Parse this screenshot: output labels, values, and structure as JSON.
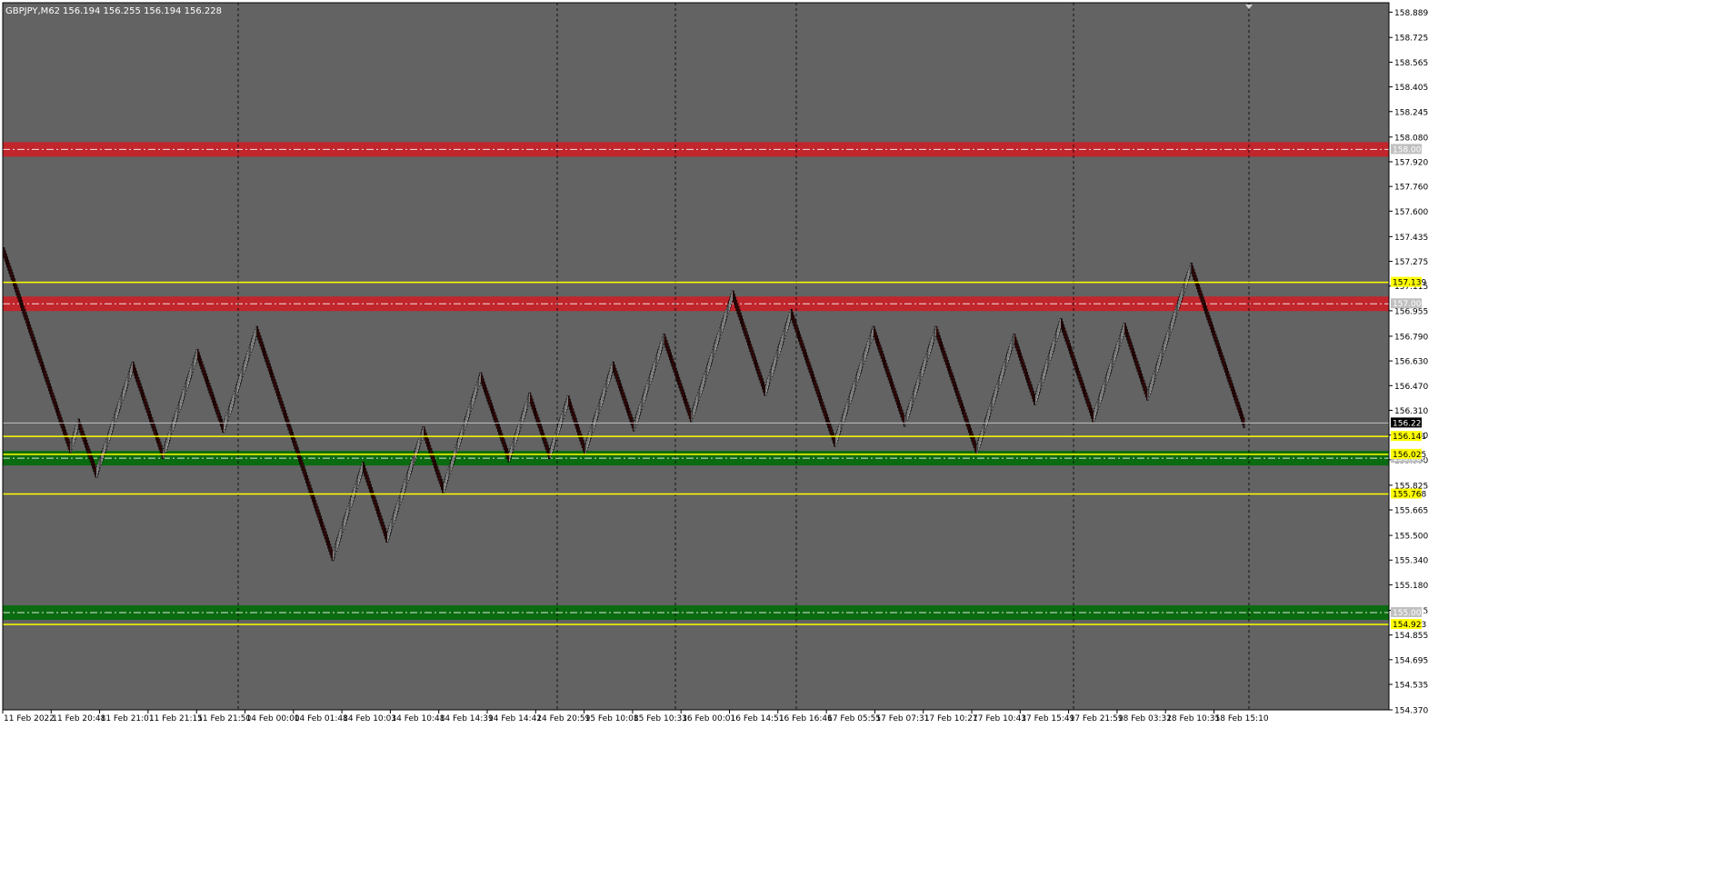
{
  "header": {
    "symbol": "GBPJPY,M62",
    "ohlc": "156.194 156.255 156.194 156.228"
  },
  "colors": {
    "plot_bg": "#636363",
    "axis_bg": "#ffffff",
    "bull_fill": "#ffffff",
    "bull_outline": "#000000",
    "bear_fill": "#5a0f0f",
    "bear_outline": "#000000",
    "red_zone": "#c0262c",
    "green_zone": "#0b6b10",
    "yellow_line": "#ffff00",
    "bid_line": "#c0c0c0",
    "grid": "#000000"
  },
  "chart_data": {
    "type": "renko",
    "ylim": [
      154.37,
      158.95
    ],
    "grid": "vertical dashed",
    "y_ticks": [
      "158.889",
      "158.725",
      "158.565",
      "158.405",
      "158.245",
      "158.080",
      "157.920",
      "157.760",
      "157.600",
      "157.435",
      "157.275",
      "157.115",
      "156.955",
      "156.790",
      "156.630",
      "156.470",
      "156.310",
      "156.150",
      "155.990",
      "155.825",
      "155.665",
      "155.500",
      "155.340",
      "155.180",
      "155.015",
      "154.855",
      "154.695",
      "154.535",
      "154.370"
    ],
    "x_labels": [
      "11 Feb 2022",
      "11 Feb 20:48",
      "11 Feb 21:01",
      "11 Feb 21:15",
      "11 Feb 21:50",
      "14 Feb 00:00",
      "14 Feb 01:48",
      "14 Feb 10:03",
      "14 Feb 10:48",
      "14 Feb 14:39",
      "14 Feb 14:42",
      "14 Feb 20:59",
      "15 Feb 10:08",
      "15 Feb 10:33",
      "16 Feb 00:01",
      "16 Feb 14:51",
      "16 Feb 16:46",
      "17 Feb 05:55",
      "17 Feb 07:31",
      "17 Feb 10:27",
      "17 Feb 10:43",
      "17 Feb 15:49",
      "17 Feb 21:59",
      "18 Feb 03:32",
      "18 Feb 10:35",
      "18 Feb 15:10"
    ],
    "brick_size": 0.02,
    "swings": [
      157.34,
      156.06,
      156.23,
      156.21,
      155.9,
      156.6,
      156.02,
      156.68,
      156.19,
      156.83,
      155.36,
      155.95,
      155.48,
      156.18,
      155.8,
      156.53,
      156.0,
      156.4,
      156.02,
      156.38,
      156.05,
      156.6,
      156.2,
      156.78,
      156.26,
      157.06,
      156.43,
      156.94,
      156.1,
      156.83,
      156.23,
      156.83,
      156.05,
      156.78,
      156.37,
      156.88,
      156.26,
      156.85,
      156.4,
      157.24,
      156.22
    ],
    "zones": [
      {
        "kind": "red",
        "center": 158.0,
        "label": "158.000"
      },
      {
        "kind": "red",
        "center": 157.0,
        "label": "157.000"
      },
      {
        "kind": "green",
        "center": 156.0,
        "label": "156.000"
      },
      {
        "kind": "green",
        "center": 155.0,
        "label": "155.000"
      }
    ],
    "levels": [
      {
        "kind": "yellow",
        "value": 157.139,
        "label": "157.139"
      },
      {
        "kind": "yellow",
        "value": 156.141,
        "label": "156.141"
      },
      {
        "kind": "yellow",
        "value": 156.025,
        "label": "156.025"
      },
      {
        "kind": "yellow",
        "value": 155.768,
        "label": "155.768"
      },
      {
        "kind": "yellow",
        "value": 154.923,
        "label": "154.923"
      },
      {
        "kind": "bid",
        "value": 156.228,
        "label": "156.228"
      }
    ]
  }
}
